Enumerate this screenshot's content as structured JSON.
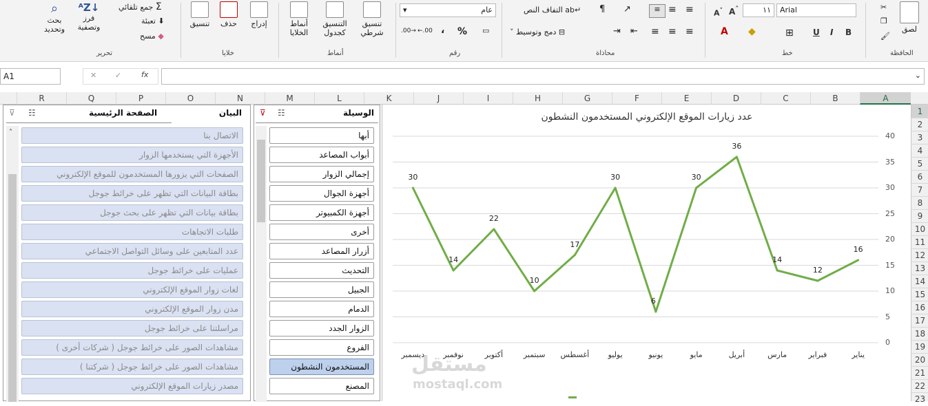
{
  "ribbon": {
    "clipboard": {
      "paste": "لصق",
      "group": "الحافظة"
    },
    "font": {
      "name": "Arial",
      "size": "١١",
      "group": "خط",
      "bold": "B",
      "italic": "I",
      "underline": "U"
    },
    "alignment": {
      "wrap": "التفاف النص",
      "merge": "دمج وتوسيط",
      "group": "محاذاة"
    },
    "number": {
      "format": "عام",
      "percent": "%",
      "comma": "،",
      "group": "رقم"
    },
    "styles": {
      "conditional": "تنسيق شرطي",
      "as_table": "التنسيق كجدول",
      "cell_styles": "أنماط الخلايا",
      "group": "أنماط"
    },
    "cells": {
      "insert": "إدراج",
      "delete": "حذف",
      "format": "تنسيق",
      "group": "خلايا"
    },
    "editing": {
      "autosum": "جمع تلقائي",
      "fill": "تعبئة",
      "clear": "مسح",
      "sort": "فرز وتصفية",
      "find": "بحث وتحديد",
      "group": "تحرير"
    }
  },
  "formula_bar": {
    "name_box": "A1",
    "fx": "fx",
    "cancel": "✕",
    "enter": "✓"
  },
  "columns": [
    "A",
    "B",
    "C",
    "D",
    "E",
    "F",
    "G",
    "H",
    "I",
    "J",
    "K",
    "L",
    "M",
    "N",
    "O",
    "P",
    "Q",
    "R"
  ],
  "rows": [
    "1",
    "2",
    "3",
    "4",
    "5",
    "6",
    "7",
    "8",
    "9",
    "10",
    "11",
    "12",
    "13",
    "14",
    "15",
    "16",
    "17",
    "18",
    "19",
    "20",
    "21",
    "22",
    "23"
  ],
  "slicer_main": {
    "title": "الصفحة الرئيسية",
    "subtitle": "البيان",
    "items": [
      "الاتصال بنا",
      "الأجهزة التي يستخدمها الزوار",
      "الصفحات التي يزورها المستخدمون للموقع الإلكتروني",
      "بطاقة البيانات التي تظهر على خرائط جوجل",
      "بطاقة بيانات التي تظهر على بحث جوجل",
      "طلبات الاتجاهات",
      "عدد المتابعين على وسائل التواصل الاجتماعي",
      "عمليات على خرائط جوجل",
      "لغات زوار الموقع الإلكتروني",
      "مدن زوار الموقع الإلكتروني",
      "مراسلتنا على خرائط جوجل",
      "مشاهدات الصور على خرائط جوجل ( شركات أخرى )",
      "مشاهدات الصور على خرائط جوجل ( شركتنا )",
      "مصدر زيارات الموقع الإلكتروني"
    ]
  },
  "slicer_channel": {
    "title": "الوسيلة",
    "items": [
      "أبها",
      "أبواب المصاعد",
      "إجمالي الزوار",
      "أجهزة الجوال",
      "أجهزة الكمبيوتر",
      "أخرى",
      "أزرار المصاعد",
      "التحديث",
      "الجبيل",
      "الدمام",
      "الزوار الجدد",
      "الفروع",
      "المستخدمون النشطون",
      "المصنع"
    ],
    "selected_index": 12
  },
  "chart_data": {
    "type": "line",
    "title": "عدد زيارات الموقع الإلكتروني المستخدمون النشطون",
    "categories": [
      "يناير",
      "فبراير",
      "مارس",
      "أبريل",
      "مايو",
      "يونيو",
      "يوليو",
      "أغسطس",
      "سبتمبر",
      "أكتوبر",
      "نوفمبر",
      "ديسمبر"
    ],
    "series": [
      {
        "name": "",
        "values": [
          16,
          12,
          14,
          36,
          30,
          6,
          30,
          17,
          10,
          22,
          14,
          30
        ]
      }
    ],
    "ylim": [
      0,
      40
    ],
    "yticks": [
      0,
      5,
      10,
      15,
      20,
      25,
      30,
      35,
      40
    ],
    "grid": true,
    "color": "#70ad47",
    "x_direction": "right-to-left"
  },
  "watermark": {
    "ar": "مستقل",
    "en": "mostaql.com"
  },
  "colors": {
    "accent": "#217346",
    "slicer_selected": "#bdd0ec",
    "line": "#70ad47"
  }
}
